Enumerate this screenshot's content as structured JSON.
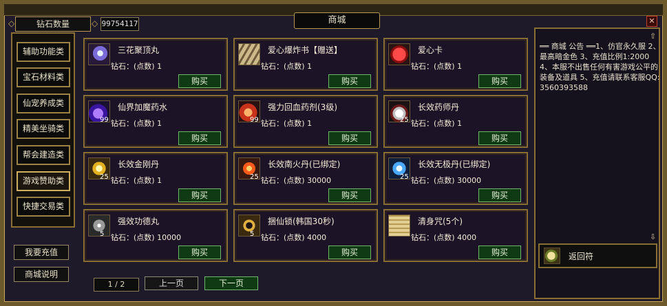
{
  "window": {
    "title": "商城",
    "close_label": "✕"
  },
  "diamond": {
    "label": "钻石数量",
    "count": "99754117"
  },
  "categories": [
    {
      "label": "辅助功能类"
    },
    {
      "label": "宝石材料类"
    },
    {
      "label": "仙宠养成类"
    },
    {
      "label": "精美坐骑类"
    },
    {
      "label": "帮会建造类"
    },
    {
      "label": "游戏赞助类"
    },
    {
      "label": "快捷交易类"
    }
  ],
  "side_buttons": {
    "recharge": "我要充值",
    "help": "商城说明"
  },
  "items": [
    {
      "name": "三花聚顶丸",
      "price": "钻石：(点数) 1",
      "buy": "购买",
      "stack": "",
      "icon": "pill-icon"
    },
    {
      "name": "爱心爆炸书【赠送】",
      "price": "钻石：(点数) 1",
      "buy": "购买",
      "stack": "",
      "icon": "scroll-icon"
    },
    {
      "name": "爱心卡",
      "price": "钻石：(点数) 1",
      "buy": "购买",
      "stack": "",
      "icon": "heart-icon"
    },
    {
      "name": "仙界加魔药水",
      "price": "钻石：(点数) 1",
      "buy": "购买",
      "stack": "99",
      "icon": "potion-icon"
    },
    {
      "name": "强力回血药剂(3级)",
      "price": "钻石：(点数) 1",
      "buy": "购买",
      "stack": "99",
      "icon": "potion-icon"
    },
    {
      "name": "长效药师丹",
      "price": "钻石：(点数) 1",
      "buy": "购买",
      "stack": "25",
      "icon": "pill-icon"
    },
    {
      "name": "长效金刚丹",
      "price": "钻石：(点数) 1",
      "buy": "购买",
      "stack": "25",
      "icon": "pill-icon"
    },
    {
      "name": "长效南火丹(已绑定)",
      "price": "钻石：(点数) 30000",
      "buy": "购买",
      "stack": "25",
      "icon": "pill-icon"
    },
    {
      "name": "长效无极丹(已绑定)",
      "price": "钻石：(点数) 30000",
      "buy": "购买",
      "stack": "25",
      "icon": "pill-icon"
    },
    {
      "name": "强效功德丸",
      "price": "钻石：(点数) 10000",
      "buy": "购买",
      "stack": "5",
      "icon": "pill-icon"
    },
    {
      "name": "捆仙锁(韩国30秒)",
      "price": "钻石：(点数) 4000",
      "buy": "购买",
      "stack": "5",
      "icon": "ring-icon"
    },
    {
      "name": "清身咒(5个)",
      "price": "钻石：(点数) 4000",
      "buy": "购买",
      "stack": "",
      "icon": "scroll-icon"
    }
  ],
  "pagination": {
    "page": "1 / 2",
    "prev": "上一页",
    "next": "下一页"
  },
  "notice": {
    "text": "══ 商城 公告 ══1、仿官永久服 2、最高暗金色 3、充值比例1:2000 4、本服不出售任何有害游戏公平的装备及道具 5、充值请联系客服QQ: 3560393588"
  },
  "recall": {
    "label": "返回符"
  },
  "colors": {
    "gold_border": "#8a6f35",
    "buy_green": "#0f3a14",
    "card_bg": "#1c1426"
  }
}
